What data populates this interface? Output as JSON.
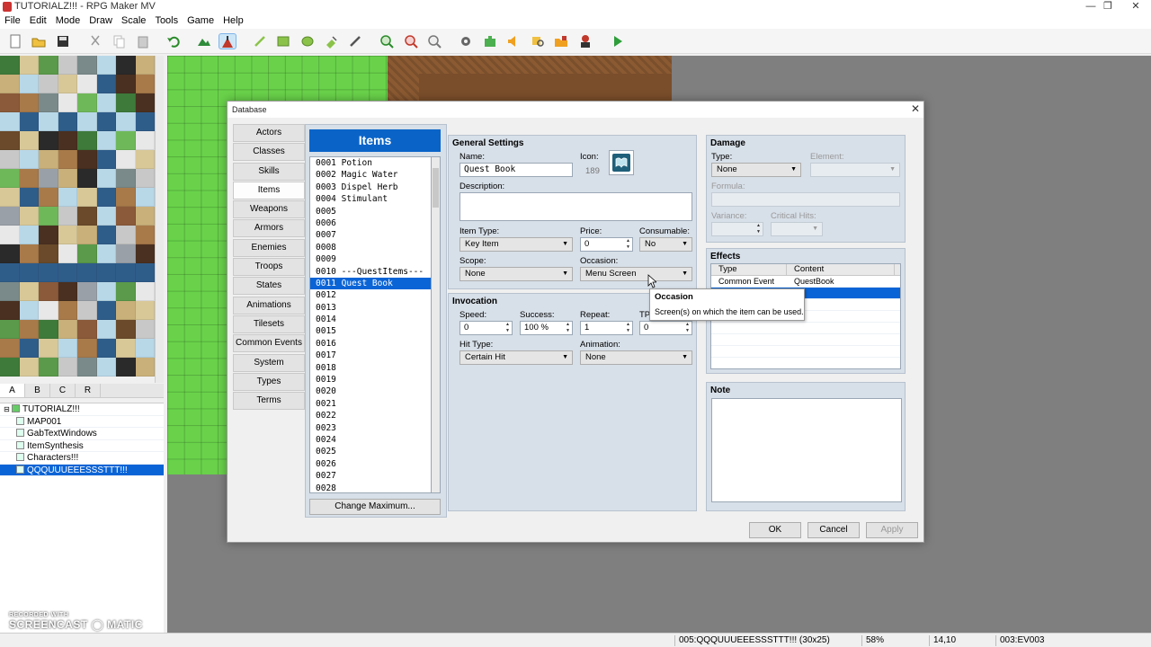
{
  "window": {
    "title": "TUTORIALZ!!! - RPG Maker MV"
  },
  "menu": [
    "File",
    "Edit",
    "Mode",
    "Draw",
    "Scale",
    "Tools",
    "Game",
    "Help"
  ],
  "tileset_tabs": [
    "A",
    "B",
    "C",
    "R"
  ],
  "map_tree": [
    {
      "label": "TUTORIALZ!!!",
      "level": 0
    },
    {
      "label": "MAP001",
      "level": 1
    },
    {
      "label": "GabTextWindows",
      "level": 1
    },
    {
      "label": "ItemSynthesis",
      "level": 1
    },
    {
      "label": "Characters!!!",
      "level": 1
    },
    {
      "label": "QQQUUUEEESSSTTT!!!",
      "level": 1,
      "selected": true
    }
  ],
  "status": {
    "map": "005:QQQUUUEEESSSTTT!!! (30x25)",
    "zoom": "58%",
    "coords": "14,10",
    "event": "003:EV003"
  },
  "watermark": {
    "line1": "RECORDED WITH",
    "line2": "SCREENCAST ◯ MATIC"
  },
  "database": {
    "title": "Database",
    "nav": [
      "Actors",
      "Classes",
      "Skills",
      "Items",
      "Weapons",
      "Armors",
      "Enemies",
      "Troops",
      "States",
      "Animations",
      "Tilesets",
      "Common Events",
      "System",
      "Types",
      "Terms"
    ],
    "nav_selected": "Items",
    "list_header": "Items",
    "items": [
      "0001 Potion",
      "0002 Magic Water",
      "0003 Dispel Herb",
      "0004 Stimulant",
      "0005",
      "0006",
      "0007",
      "0008",
      "0009",
      "0010 ---QuestItems---",
      "0011 Quest Book",
      "0012",
      "0013",
      "0014",
      "0015",
      "0016",
      "0017",
      "0018",
      "0019",
      "0020",
      "0021",
      "0022",
      "0023",
      "0024",
      "0025",
      "0026",
      "0027",
      "0028"
    ],
    "items_selected_index": 10,
    "change_max": "Change Maximum...",
    "general": {
      "heading": "General Settings",
      "name_label": "Name:",
      "name": "Quest Book",
      "icon_label": "Icon:",
      "icon_index": "189",
      "description_label": "Description:",
      "description": "",
      "item_type_label": "Item Type:",
      "item_type": "Key Item",
      "price_label": "Price:",
      "price": "0",
      "consumable_label": "Consumable:",
      "consumable": "No",
      "scope_label": "Scope:",
      "scope": "None",
      "occasion_label": "Occasion:",
      "occasion": "Menu Screen"
    },
    "invocation": {
      "heading": "Invocation",
      "speed_label": "Speed:",
      "speed": "0",
      "success_label": "Success:",
      "success": "100 %",
      "repeat_label": "Repeat:",
      "repeat": "1",
      "tp_label": "TP",
      "tp": "0",
      "hit_type_label": "Hit Type:",
      "hit_type": "Certain Hit",
      "animation_label": "Animation:",
      "animation": "None"
    },
    "damage": {
      "heading": "Damage",
      "type_label": "Type:",
      "type": "None",
      "element_label": "Element:",
      "element": "",
      "formula_label": "Formula:",
      "formula": "",
      "variance_label": "Variance:",
      "variance": "",
      "critical_label": "Critical Hits:",
      "critical": ""
    },
    "effects": {
      "heading": "Effects",
      "columns": [
        "Type",
        "Content"
      ],
      "rows": [
        {
          "type": "Common Event",
          "content": "QuestBook"
        },
        {
          "type": "",
          "content": ""
        }
      ]
    },
    "note": {
      "heading": "Note",
      "text": ""
    },
    "buttons": {
      "ok": "OK",
      "cancel": "Cancel",
      "apply": "Apply"
    }
  },
  "tooltip": {
    "title": "Occasion",
    "text": "Screen(s) on which the item can be used."
  },
  "colors": {
    "accent": "#0a64d6",
    "header": "#0a64c8",
    "panel": "#d7dfe8",
    "grass": "#69d24a"
  }
}
